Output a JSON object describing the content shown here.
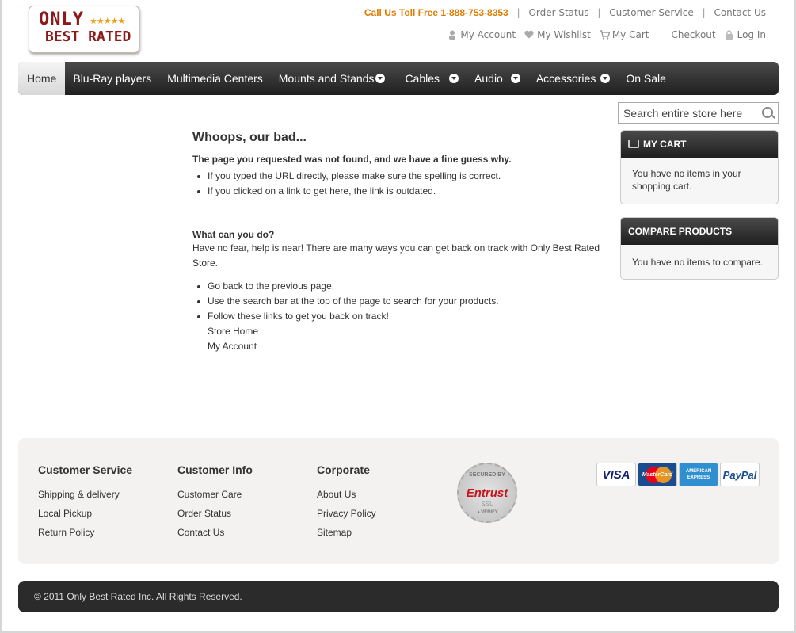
{
  "header": {
    "logo_line1": "ONLY",
    "logo_line2": "BEST RATED",
    "logo_stars": "★★★★★",
    "phone": "Call Us Toll Free 1-888-753-8353",
    "top_links": [
      "Order Status",
      "Customer Service",
      "Contact Us"
    ],
    "account_links": {
      "my_account": "My Account",
      "my_wishlist": "My Wishlist",
      "my_cart": "My Cart",
      "checkout": "Checkout",
      "login": "Log In"
    },
    "icons": {
      "account": "user-icon",
      "wishlist": "heart-icon",
      "cart": "cart-icon",
      "login": "lock-icon"
    }
  },
  "nav": {
    "items": [
      {
        "label": "Home",
        "active": true,
        "dropdown": false
      },
      {
        "label": "Blu-Ray players",
        "dropdown": false
      },
      {
        "label": "Multimedia Centers",
        "dropdown": false
      },
      {
        "label": "Mounts and Stands",
        "dropdown": true
      },
      {
        "label": "Cables",
        "dropdown": true
      },
      {
        "label": "Audio",
        "dropdown": true
      },
      {
        "label": "Accessories",
        "dropdown": true
      },
      {
        "label": "On Sale",
        "dropdown": false
      }
    ]
  },
  "search": {
    "placeholder": "Search entire store here"
  },
  "main": {
    "title": "Whoops, our bad...",
    "reason_heading": "The page you requested was not found, and we have a fine guess why.",
    "reasons": [
      "If you typed the URL directly, please make sure the spelling is correct.",
      "If you clicked on a link to get here, the link is outdated."
    ],
    "what_heading": "What can you do?",
    "what_text": "Have no fear, help is near! There are many ways you can get back on track with Only Best Rated Store.",
    "options": [
      "Go back to the previous page.",
      "Use the search bar at the top of the page to search for your products.",
      "Follow these links to get you back on track!"
    ],
    "store_home": "Store Home",
    "my_account": "My Account"
  },
  "sidebar": {
    "cart_title": "MY CART",
    "cart_text": "You have no items in your shopping cart.",
    "compare_title": "COMPARE PRODUCTS",
    "compare_text": "You have no items to compare."
  },
  "footer": {
    "columns": [
      {
        "title": "Customer Service",
        "links": [
          "Shipping & delivery",
          "Local Pickup",
          "Return Policy"
        ]
      },
      {
        "title": "Customer Info",
        "links": [
          "Customer Care",
          "Order Status",
          "Contact Us"
        ]
      },
      {
        "title": "Corporate",
        "links": [
          "About Us",
          "Privacy Policy",
          "Sitemap"
        ]
      }
    ],
    "seal": {
      "top": "SECURED BY",
      "brand": "Entrust",
      "ssl": "SSL",
      "verify": "▲VERIFY"
    },
    "cards": {
      "visa": "VISA",
      "mastercard": "MasterCard",
      "amex": "AMERICAN EXPRESS",
      "paypal": "PayPal"
    }
  },
  "copyright": "© 2011 Only Best Rated Inc. All Rights Reserved."
}
